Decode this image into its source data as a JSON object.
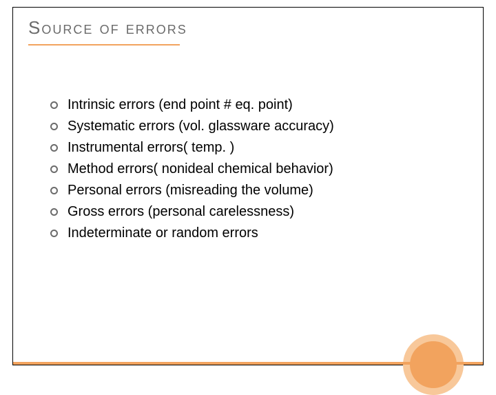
{
  "title": "Source of errors",
  "bullets": [
    "Intrinsic errors (end point # eq. point)",
    "Systematic errors (vol. glassware accuracy)",
    "Instrumental errors( temp. )",
    "Method errors( nonideal chemical behavior)",
    "Personal errors (misreading the volume)",
    "Gross errors (personal carelessness)",
    "Indeterminate or random errors"
  ],
  "theme": {
    "accent": "#f2a35e",
    "accent_light": "#f8c89a",
    "text_muted": "#6b6b6b"
  }
}
